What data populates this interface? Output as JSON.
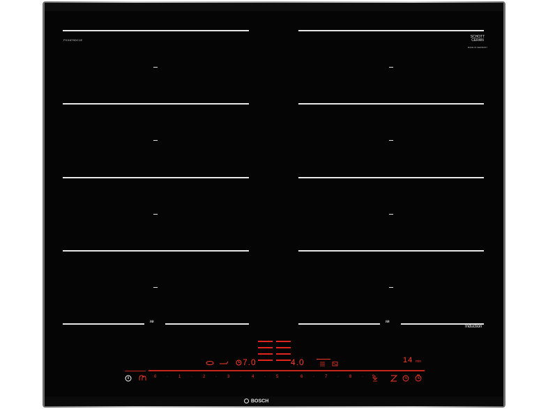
{
  "appliance": {
    "model_code": "PXX875DC1E",
    "glass_brand": [
      "SCHOTT",
      "CERAN"
    ],
    "glass_sub": "MADE IN GERMANY",
    "induction_label": "Induction",
    "brand": "BOSCH",
    "flex_label_left": "ӥӥ",
    "flex_label_right": "ӥӥ"
  },
  "controls": {
    "power_icon": "⏻",
    "zone_left_display": "7.0",
    "zone_right_display": "4.0",
    "timer_display": "14",
    "timer_unit": "min",
    "scale": [
      "0",
      "1",
      "2",
      "3",
      "4",
      "5",
      "6",
      "7",
      "8",
      "9"
    ],
    "dots": [
      "·",
      "·",
      "·",
      "·",
      "·",
      "·",
      "·",
      "·",
      "·"
    ]
  }
}
